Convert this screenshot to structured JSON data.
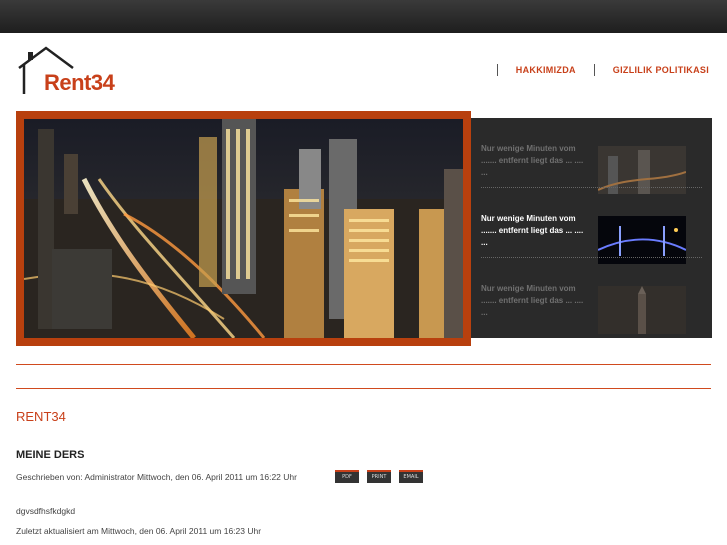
{
  "logo": {
    "text": "Rent34"
  },
  "nav": {
    "items": [
      {
        "label": "HAKKIMIZDA"
      },
      {
        "label": "GIZLILIK POLITIKASI"
      }
    ]
  },
  "hero": {
    "image": "city-night-skyline-image"
  },
  "slides": [
    {
      "text": "Nur wenige Minuten vom ....... entfernt liegt das ...  .... ...",
      "thumb": "skyline-thumb",
      "active": false
    },
    {
      "text": "Nur wenige Minuten vom ....... entfernt liegt das ...  .... ...",
      "thumb": "bridge-night-thumb",
      "active": true
    },
    {
      "text": "Nur wenige Minuten vom ....... entfernt liegt das ...  .... ...",
      "thumb": "tower-thumb",
      "active": false
    }
  ],
  "content": {
    "site_title": "RENT34",
    "article_title": "MEINE DERS",
    "meta": "Geschrieben von: Administrator Mittwoch, den 06. April 2011 um 16:22 Uhr",
    "icons": [
      {
        "label": "PDF"
      },
      {
        "label": "PRINT"
      },
      {
        "label": "EMAIL"
      }
    ],
    "body": "dgvsdfhsfkdgkd",
    "updated": "Zuletzt aktualisiert am Mittwoch, den 06. April 2011 um 16:23 Uhr"
  },
  "colors": {
    "accent": "#c8401a",
    "frame": "#b8400e",
    "dark_panel": "#2a2a2a"
  }
}
